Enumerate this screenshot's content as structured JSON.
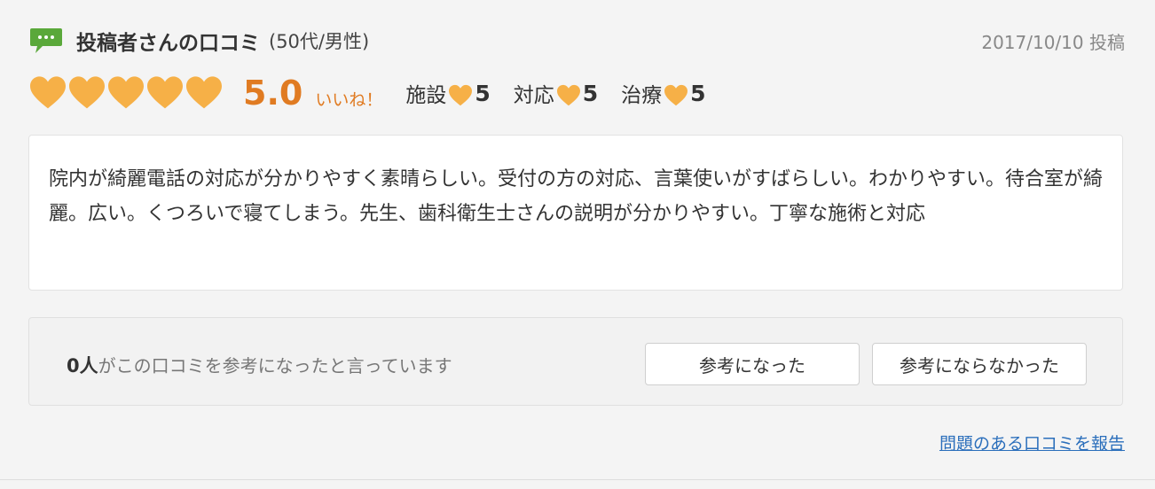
{
  "header": {
    "icon": "chat-bubble-icon",
    "title": "投稿者さんの口コミ",
    "meta": "(50代/男性)",
    "date": "2017/10/10 投稿"
  },
  "rating": {
    "hearts": 5,
    "heart_color": "#f6b047",
    "score": "5.0",
    "iine": "いいね！",
    "sub_ratings": [
      {
        "label": "施設",
        "value": "5"
      },
      {
        "label": "対応",
        "value": "5"
      },
      {
        "label": "治療",
        "value": "5"
      }
    ]
  },
  "review": {
    "text": "院内が綺麗電話の対応が分かりやすく素晴らしい。受付の方の対応、言葉使いがすばらしい。わかりやすい。待合室が綺麗。広い。くつろいで寝てしまう。先生、歯科衛生士さんの説明が分かりやすい。丁寧な施術と対応"
  },
  "helpful": {
    "count": "0人",
    "text": "がこの口コミを参考になったと言っています",
    "yes_label": "参考になった",
    "no_label": "参考にならなかった"
  },
  "report_link": "問題のある口コミを報告",
  "colors": {
    "accent": "#e07b22",
    "icon_green": "#5aa83a",
    "link": "#2a6ebb"
  }
}
